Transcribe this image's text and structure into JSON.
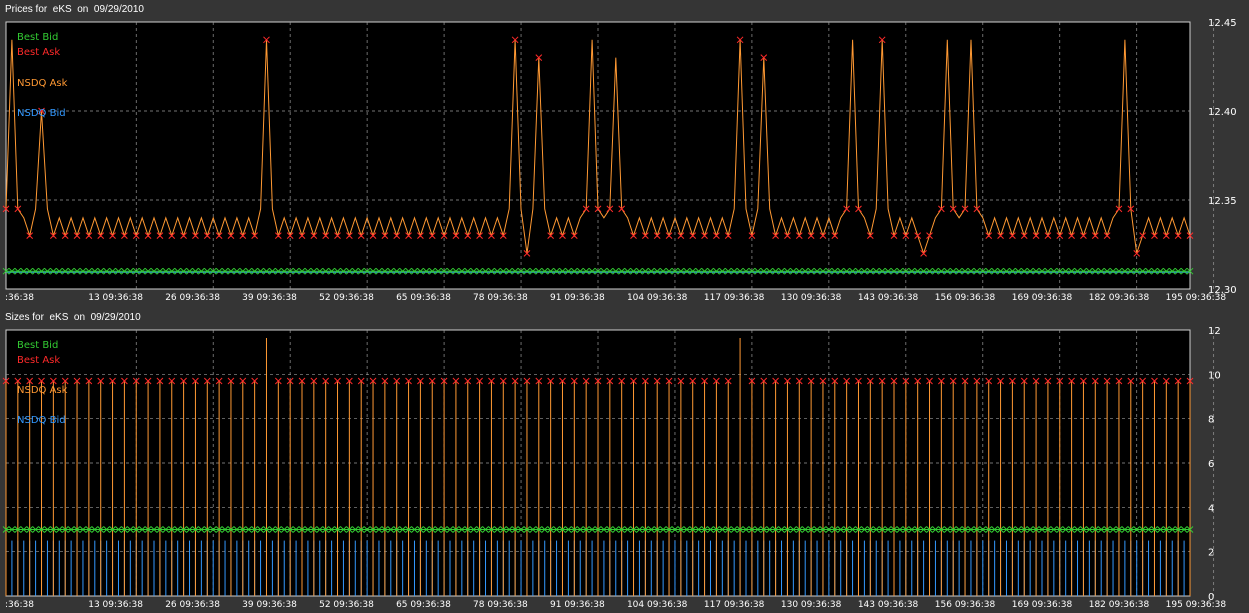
{
  "window": {
    "background": "#353535",
    "plot_background": "#000000"
  },
  "chart_data": [
    {
      "type": "line",
      "title": "Prices for  eKS  on  09/29/2010",
      "xlabel": "",
      "ylabel": "",
      "x_tick_labels": [
        ":36:38",
        "13 09:36:38",
        "26 09:36:38",
        "39 09:36:38",
        "52 09:36:38",
        "65 09:36:38",
        "78 09:36:38",
        "91 09:36:38",
        "104 09:36:38",
        "117 09:36:38",
        "130 09:36:38",
        "143 09:36:38",
        "156 09:36:38",
        "169 09:36:38",
        "182 09:36:38",
        "195 09:36:38"
      ],
      "y_ticks": [
        "12.45",
        "12.40",
        "12.35",
        "12.30"
      ],
      "ylim": [
        12.3,
        12.45
      ],
      "xlim": [
        0,
        200
      ],
      "grid": true,
      "legend_position": "top-left",
      "series": [
        {
          "name": "Best Bid",
          "color": "#33cc33",
          "marker": "x",
          "line": "12.31 constant"
        },
        {
          "name": "Best Ask",
          "color": "#ff2a2a",
          "marker": "x"
        },
        {
          "name": "NSDQ Ask",
          "color": "#ff9933"
        },
        {
          "name": "NSDQ Bid",
          "color": "#3399ff"
        }
      ],
      "ask_base": 12.33,
      "ask_zigzag_high": 12.34,
      "bid_level": 12.31,
      "ask_spikes": [
        {
          "x": 1,
          "y": 12.44
        },
        {
          "x": 6,
          "y": 12.4
        },
        {
          "x": 44,
          "y": 12.44
        },
        {
          "x": 86,
          "y": 12.44
        },
        {
          "x": 90,
          "y": 12.43
        },
        {
          "x": 99,
          "y": 12.44
        },
        {
          "x": 103,
          "y": 12.43
        },
        {
          "x": 124,
          "y": 12.44
        },
        {
          "x": 128,
          "y": 12.43
        },
        {
          "x": 143,
          "y": 12.44
        },
        {
          "x": 148,
          "y": 12.44
        },
        {
          "x": 159,
          "y": 12.44
        },
        {
          "x": 163,
          "y": 12.44
        },
        {
          "x": 189,
          "y": 12.44
        }
      ],
      "ask_dips": [
        {
          "x": 88,
          "y": 12.32
        },
        {
          "x": 155,
          "y": 12.32
        },
        {
          "x": 191,
          "y": 12.32
        }
      ]
    },
    {
      "type": "line",
      "title": "Sizes for  eKS  on  09/29/2010",
      "xlabel": "",
      "ylabel": "",
      "x_tick_labels": [
        ":36:38",
        "13 09:36:38",
        "26 09:36:38",
        "39 09:36:38",
        "52 09:36:38",
        "65 09:36:38",
        "78 09:36:38",
        "91 09:36:38",
        "104 09:36:38",
        "117 09:36:38",
        "130 09:36:38",
        "143 09:36:38",
        "156 09:36:38",
        "169 09:36:38",
        "182 09:36:38",
        "195 09:36:38"
      ],
      "y_ticks": [
        "12",
        "10",
        "8",
        "6",
        "4",
        "2",
        "0"
      ],
      "ylim": [
        0,
        12
      ],
      "xlim": [
        0,
        200
      ],
      "grid": true,
      "legend_position": "top-left",
      "series": [
        {
          "name": "Best Bid",
          "color": "#33cc33",
          "level": 3
        },
        {
          "name": "Best Ask",
          "color": "#ff2a2a",
          "level": 10
        },
        {
          "name": "NSDQ Ask",
          "color": "#ff9933",
          "level": 10
        },
        {
          "name": "NSDQ Bid",
          "color": "#3399ff",
          "level": 2
        }
      ],
      "ask_size_spikes": [
        {
          "x": 44,
          "y": 12
        },
        {
          "x": 124,
          "y": 12
        },
        {
          "x": 189,
          "y": 12
        }
      ]
    }
  ]
}
